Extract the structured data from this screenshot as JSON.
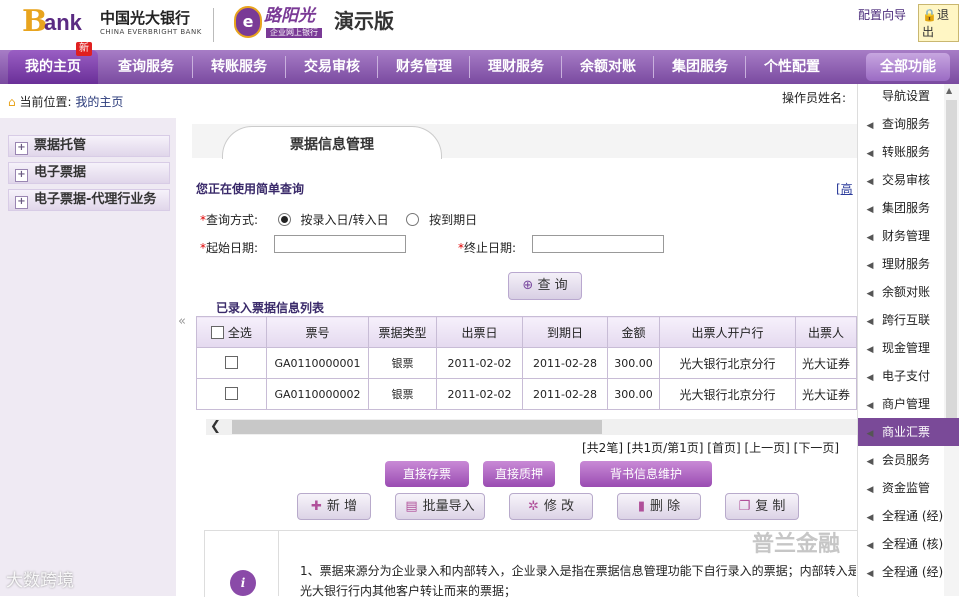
{
  "header": {
    "logo_b": "B",
    "logo_ank": "ank",
    "logo_cn": "中国光大银行",
    "logo_en": "CHINA EVERBRIGHT BANK",
    "brand_badge": "e",
    "brand_title": "路阳光",
    "brand_sub": "企业网上银行",
    "demo_label": "演示版",
    "config_link": "配置向导",
    "logout": "退出"
  },
  "nav": {
    "items": [
      "我的主页",
      "查询服务",
      "转账服务",
      "交易审核",
      "财务管理",
      "理财服务",
      "余额对账",
      "集团服务",
      "个性配置"
    ],
    "new_badge": "新",
    "all_functions": "全部功能"
  },
  "breadcrumb": {
    "prefix": "当前位置:",
    "current": "我的主页"
  },
  "operator_label": "操作员姓名:",
  "left_tree": [
    "票据托管",
    "电子票据",
    "电子票据-代理行业务"
  ],
  "collapse_icon": "«",
  "main": {
    "tab_title": "票据信息管理",
    "mode_text": "您正在使用简单查询",
    "advanced_link": "[高",
    "query_mode_label": "查询方式:",
    "radio_1": "按录入日/转入日",
    "radio_2": "按到期日",
    "start_label": "起始日期:",
    "end_label": "终止日期:",
    "start_value": "",
    "end_value": "",
    "query_button": "查 询",
    "list_title": "已录入票据信息列表",
    "table": {
      "select_all": "全选",
      "headers": [
        "票号",
        "票据类型",
        "出票日",
        "到期日",
        "金额",
        "出票人开户行",
        "出票人"
      ],
      "rows": [
        [
          "GA0110000001",
          "银票",
          "2011-02-02",
          "2011-02-28",
          "300.00",
          "光大银行北京分行",
          "光大证券"
        ],
        [
          "GA0110000002",
          "银票",
          "2011-02-02",
          "2011-02-28",
          "300.00",
          "光大银行北京分行",
          "光大证券"
        ]
      ]
    },
    "pager": "[共2笔] [共1页/第1页] [首页] [上一页] [下一页]",
    "purple_buttons": [
      "直接存票",
      "直接质押",
      "背书信息维护"
    ],
    "action_buttons": [
      {
        "icon": "✚",
        "label": "新 增"
      },
      {
        "icon": "▤",
        "label": "批量导入"
      },
      {
        "icon": "✲",
        "label": "修 改"
      },
      {
        "icon": "▮",
        "label": "删 除"
      },
      {
        "icon": "❐",
        "label": "复 制"
      }
    ],
    "info_icon": "i",
    "info_line1": "1、票据来源分为企业录入和内部转入，企业录入是指在票据信息管理功能下自行录入的票据；内部转入是",
    "info_line2": "光大银行行内其他客户转让而来的票据；"
  },
  "right_menu": [
    "导航设置",
    "查询服务",
    "转账服务",
    "交易审核",
    "集团服务",
    "财务管理",
    "理财服务",
    "余额对账",
    "跨行互联",
    "现金管理",
    "电子支付",
    "商户管理",
    "商业汇票",
    "会员服务",
    "资金监管",
    "全程通 (经)",
    "全程通 (核)",
    "全程通 (经)"
  ],
  "right_menu_active": "商业汇票",
  "watermarks": {
    "wechat": "普兰金融",
    "bottom_left": "大数跨境"
  },
  "colors": {
    "nav_purple": "#7a4aa0",
    "active_purple": "#7a4a98",
    "required_red": "#e00000"
  }
}
